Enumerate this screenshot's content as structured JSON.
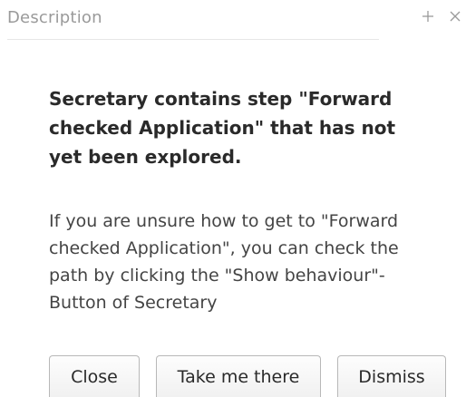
{
  "header": {
    "title": "Description",
    "add_icon": "plus-icon",
    "close_icon": "close-icon"
  },
  "message": {
    "title": "Secretary contains step \"Forward checked Application\" that has not yet been explored.",
    "body": "If you are unsure how to get to \"Forward checked Application\", you can check the path by clicking the \"Show behaviour\"-Button of Secretary"
  },
  "actions": {
    "close_label": "Close",
    "take_me_there_label": "Take me there",
    "dismiss_label": "Dismiss"
  }
}
